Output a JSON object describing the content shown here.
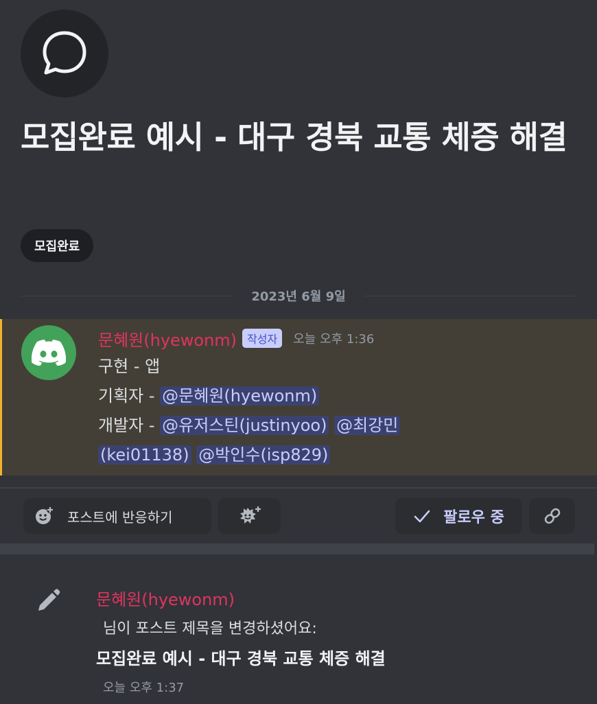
{
  "post": {
    "title": "모집완료 예시 - 대구 경북 교통 체증 해결",
    "tag": "모집완료"
  },
  "date_divider": "2023년 6월 9일",
  "message": {
    "author": "문혜원(hyewonm)",
    "op_badge": "작성자",
    "timestamp": "오늘 오후 1:36",
    "lines": {
      "line1": "구현 - 앱",
      "planner_label": "기획자 - ",
      "planner_mention": "@문혜원(hyewonm)",
      "dev_label": "개발자 - ",
      "dev_mentions": [
        "@유저스틴(justinyoo)",
        "@최강민",
        "(kei01138)",
        "@박인수(isp829)"
      ]
    }
  },
  "actions": {
    "react_label": "포스트에 반응하기",
    "follow_label": "팔로우 중"
  },
  "system_message": {
    "author": "문혜원(hyewonm)",
    "text": "님이 포스트 제목을 변경하셨어요:",
    "new_title": "모집완료 예시 - 대구 경북 교통 체증 해결",
    "timestamp": "오늘 오후 1:37"
  },
  "colors": {
    "background": "#313338",
    "username": "#e0345e",
    "highlight_bg": "#433f36",
    "highlight_bar": "#f0b232",
    "mention_bg": "#3c4270",
    "mention_text": "#c9cdfb",
    "avatar_green": "#43a25a"
  },
  "icons": [
    "chat-bubble-icon",
    "discord-logo-icon",
    "add-reaction-icon",
    "super-reaction-icon",
    "checkmark-icon",
    "link-icon",
    "pencil-icon"
  ]
}
